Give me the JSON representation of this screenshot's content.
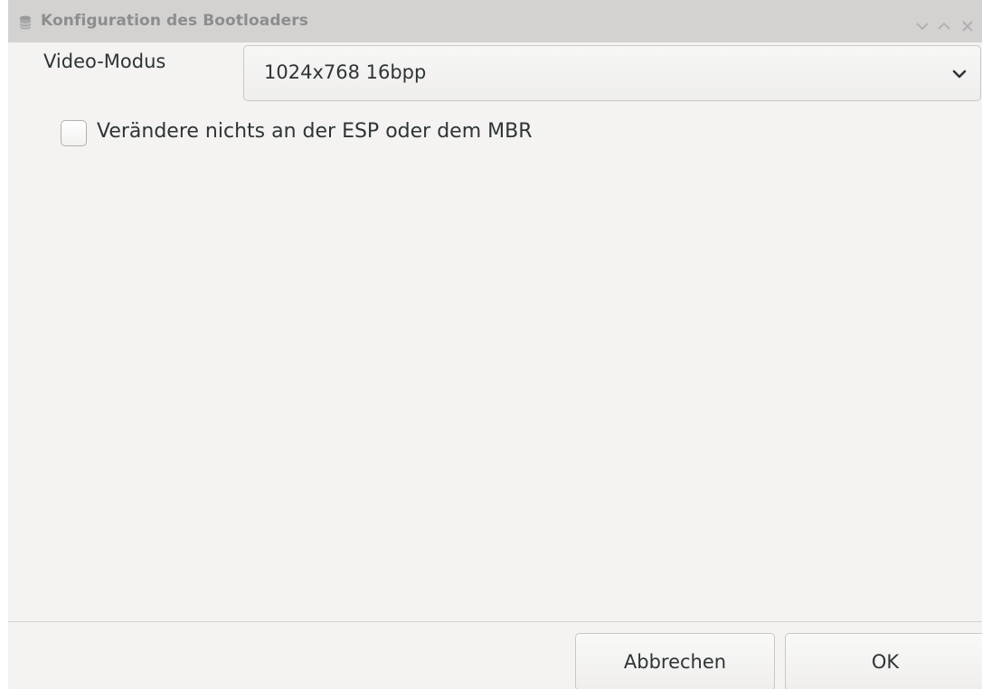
{
  "window": {
    "title": "Konfiguration des Bootloaders",
    "icons": {
      "app": "database-icon",
      "minimize": "chevron-down-icon",
      "maximize": "chevron-up-icon",
      "close": "close-icon"
    }
  },
  "form": {
    "video_mode_label": "Video-Modus",
    "video_mode_value": "1024x768 16bpp",
    "checkbox_label": "Verändere nichts an der ESP oder dem MBR",
    "checkbox_checked": false
  },
  "buttons": {
    "cancel_label": "Abbrechen",
    "ok_label": "OK"
  },
  "colors": {
    "titlebar": "#d3d2d1",
    "title_text": "#8d8d8d",
    "window_bg": "#f4f3f2",
    "text": "#2e3436"
  }
}
